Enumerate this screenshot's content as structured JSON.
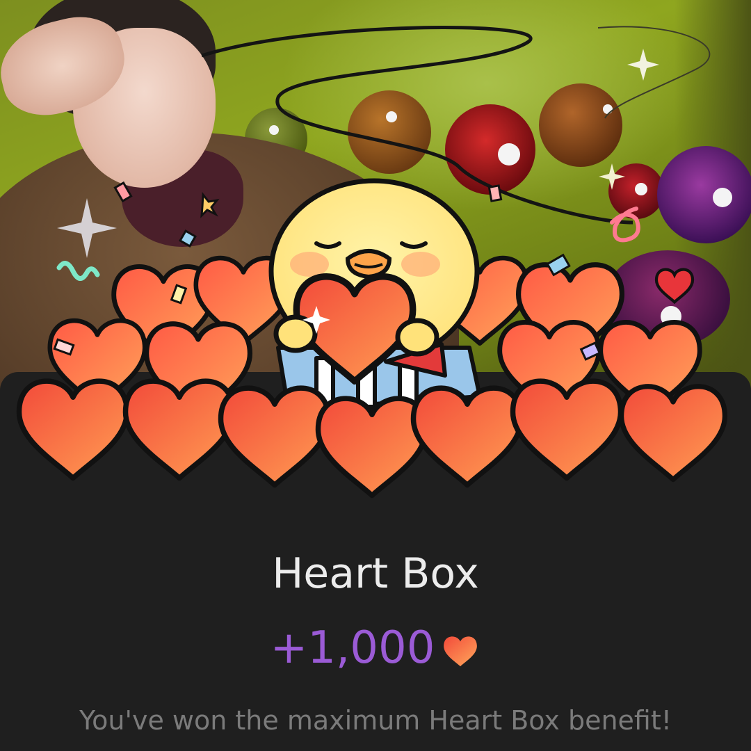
{
  "reward": {
    "title": "Heart Box",
    "amount": "+1,000",
    "currency_icon": "heart-icon",
    "message": "You've won the maximum Heart Box benefit!"
  },
  "colors": {
    "panel_background": "#1f1f1f",
    "title_text": "#ececec",
    "amount_text": "#9b5bd6",
    "message_text": "#7b7b7b",
    "heart_light": "#ff9a52",
    "heart_dark": "#f04a3a"
  },
  "illustration": {
    "character": "yellow-chick",
    "props": [
      "heart-pile",
      "gift-box",
      "confetti"
    ]
  }
}
